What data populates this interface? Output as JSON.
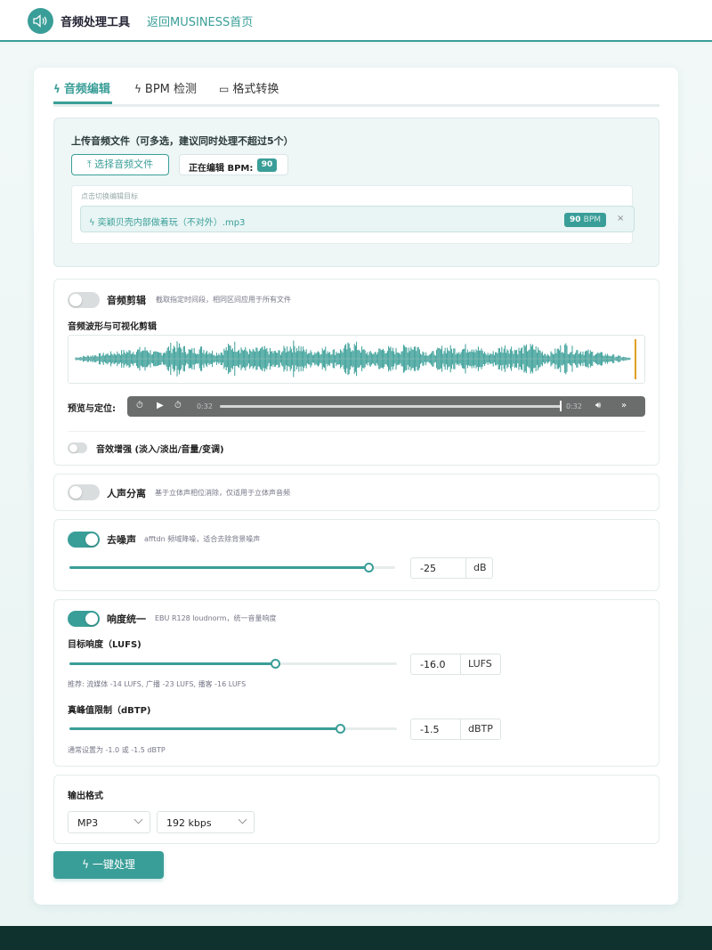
{
  "header": {
    "app_title": "音频处理工具",
    "back_link": "返回MUSINESS首页"
  },
  "tabs": [
    {
      "label": "音频编辑",
      "icon": "bolt-icon",
      "active": true
    },
    {
      "label": "BPM 检测",
      "icon": "bolt-icon",
      "active": false
    },
    {
      "label": "格式转换",
      "icon": "folder-icon",
      "active": false
    }
  ],
  "upload": {
    "title": "上传音频文件（可多选，建议同时处理不超过5个）",
    "choose_label": "选择音频文件",
    "editing_bpm_label": "正在编辑 BPM:",
    "editing_bpm_value": "90",
    "switch_hint": "点击切换编辑目标",
    "file": {
      "name": "奕颖贝壳内部做着玩（不对外）.mp3",
      "bpm": "90",
      "bpm_unit": "BPM",
      "close": "×"
    }
  },
  "trim": {
    "enabled": false,
    "title": "音频剪辑",
    "desc": "截取指定时间段，相同区间应用于所有文件",
    "waveform_label": "音频波形与可视化剪辑",
    "preview_label": "预览与定位:",
    "time_start": "0:32",
    "time_end": "0:32",
    "enhance_enabled": false,
    "enhance_label": "音效增强 (淡入/淡出/音量/变调)"
  },
  "vocal": {
    "enabled": false,
    "title": "人声分离",
    "desc": "基于立体声相位消除，仅适用于立体声音频"
  },
  "denoise": {
    "enabled": true,
    "title": "去噪声",
    "desc": "afftdn 频域降噪，适合去除背景噪声",
    "value": "-25",
    "unit": "dB",
    "level_fraction": 0.92
  },
  "loudness": {
    "enabled": true,
    "title": "响度统一",
    "desc": "EBU R128 loudnorm，统一音量响度",
    "target_label": "目标响度（LUFS)",
    "target_value": "-16.0",
    "target_unit": "LUFS",
    "target_fraction": 0.63,
    "target_hint": "推荐: 流媒体 -14 LUFS, 广播 -23 LUFS, 播客 -16 LUFS",
    "peak_label": "真峰值限制（dBTP)",
    "peak_value": "-1.5",
    "peak_unit": "dBTP",
    "peak_fraction": 0.83,
    "peak_hint": "通常设置为 -1.0 或 -1.5 dBTP"
  },
  "output": {
    "title": "输出格式",
    "format": "MP3",
    "bitrate": "192 kbps"
  },
  "process_button": "一键处理",
  "colors": {
    "accent": "#3a9e98",
    "footer": "#10322f",
    "player": "#6b6d6d"
  }
}
